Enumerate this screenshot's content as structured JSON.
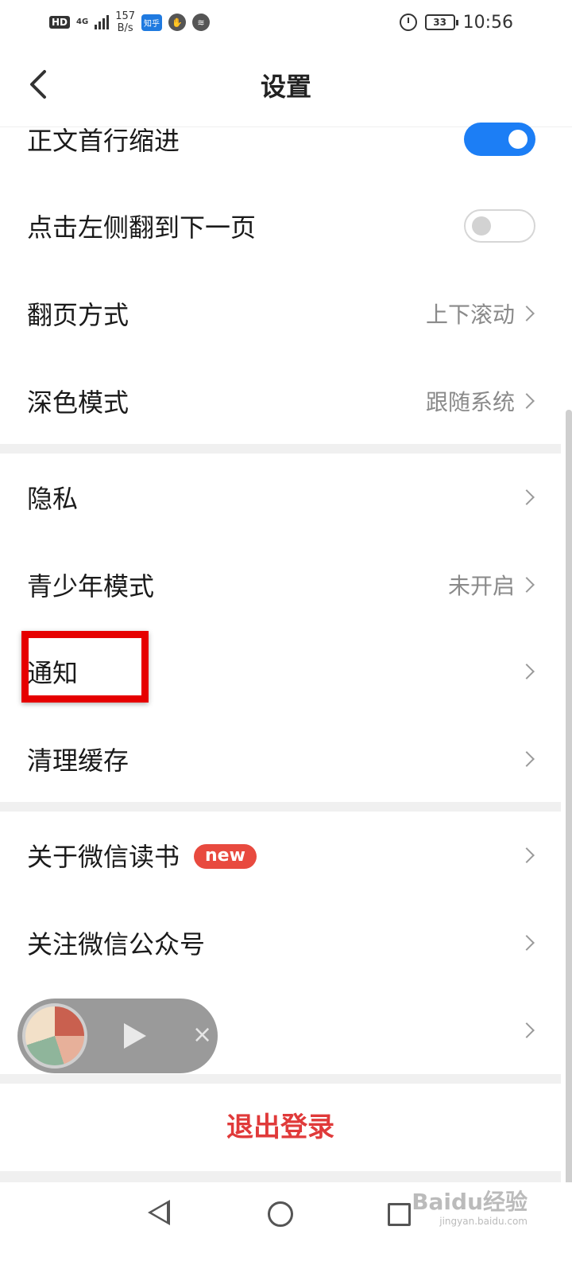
{
  "status_bar": {
    "hd": "HD",
    "network": "4G",
    "speed_value": "157",
    "speed_unit": "B/s",
    "app_label": "知乎",
    "battery": "33",
    "time": "10:56"
  },
  "header": {
    "title": "设置"
  },
  "settings": {
    "indent": {
      "label": "正文首行缩进",
      "on": true
    },
    "tap_left": {
      "label": "点击左侧翻到下一页",
      "on": false
    },
    "page_turn": {
      "label": "翻页方式",
      "value": "上下滚动"
    },
    "dark_mode": {
      "label": "深色模式",
      "value": "跟随系统"
    },
    "privacy": {
      "label": "隐私"
    },
    "teen_mode": {
      "label": "青少年模式",
      "value": "未开启"
    },
    "notification": {
      "label": "通知"
    },
    "clear_cache": {
      "label": "清理缓存"
    },
    "about": {
      "label": "关于微信读书",
      "badge": "new"
    },
    "follow": {
      "label": "关注微信公众号"
    }
  },
  "logout": {
    "label": "退出登录"
  },
  "player": {
    "close": "×"
  },
  "watermark": {
    "main": "Baidu经验",
    "sub": "jingyan.baidu.com"
  },
  "colors": {
    "accent": "#1c7ef5",
    "danger": "#e03a3a",
    "badge": "#e84a3f",
    "highlight": "#e60000"
  }
}
